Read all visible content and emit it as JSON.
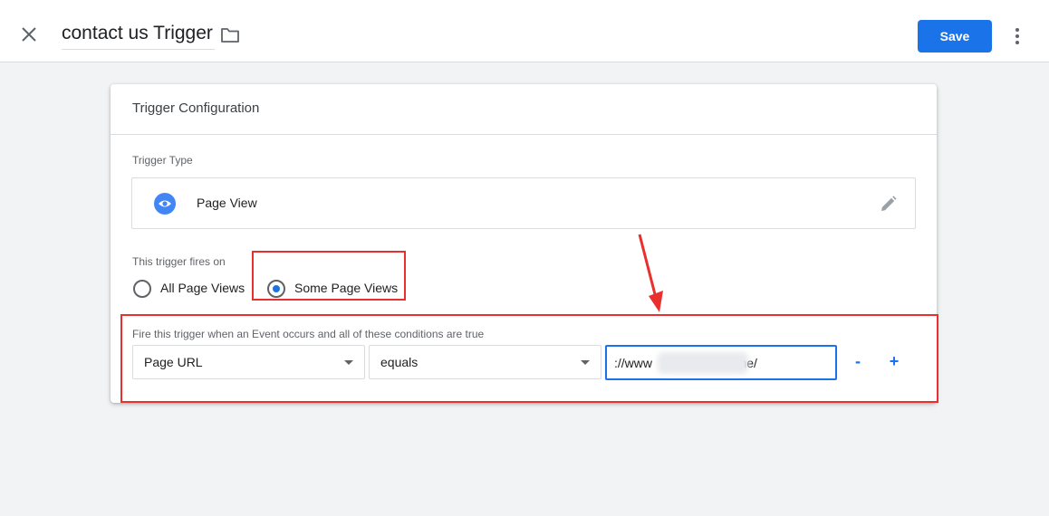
{
  "header": {
    "title": "contact us Trigger",
    "save_label": "Save",
    "icons": {
      "close": "close-icon",
      "folder": "folder-icon",
      "more": "more-vert-icon"
    }
  },
  "card": {
    "title": "Trigger Configuration",
    "trigger_type_label": "Trigger Type",
    "trigger_type": {
      "name": "Page View",
      "icon": "eye-icon",
      "edit_icon": "pencil-icon"
    },
    "fires_on_label": "This trigger fires on",
    "fires_on_options": [
      {
        "label": "All Page Views",
        "selected": false
      },
      {
        "label": "Some Page Views",
        "selected": true
      }
    ],
    "condition_label": "Fire this trigger when an Event occurs and all of these conditions are true",
    "condition": {
      "variable": "Page URL",
      "operator": "equals",
      "value": "://www          /contact-me/"
    },
    "remove_label": "-",
    "add_label": "+"
  },
  "colors": {
    "accent": "#1a73e8",
    "highlight": "#ea2f2f"
  }
}
